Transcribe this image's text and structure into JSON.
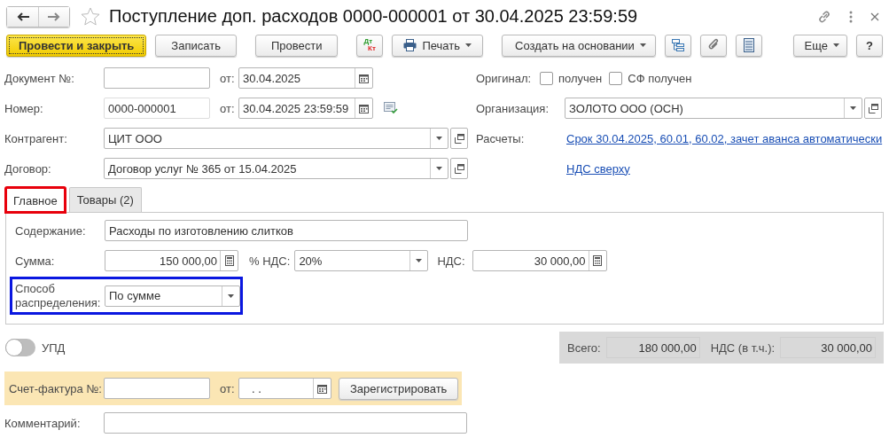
{
  "window": {
    "title": "Поступление доп. расходов 0000-000001 от 30.04.2025 23:59:59"
  },
  "toolbar": [
    {
      "kind": "primary",
      "label": "Провести и закрыть"
    },
    {
      "kind": "plain",
      "label": "Записать"
    },
    {
      "kind": "plain",
      "label": "Провести"
    },
    {
      "kind": "dtkt",
      "top": "Дт",
      "bottom": "Кт"
    },
    {
      "kind": "print",
      "label": "Печать"
    },
    {
      "kind": "menu",
      "label": "Создать на основании"
    },
    {
      "kind": "structure"
    },
    {
      "kind": "clip"
    },
    {
      "kind": "list"
    },
    {
      "kind": "more",
      "label": "Еще"
    },
    {
      "kind": "help",
      "label": "?"
    }
  ],
  "document": {
    "label": "Документ №:",
    "date_label": "от:",
    "date": "30.04.2025"
  },
  "number": {
    "label": "Номер:",
    "value": "0000-000001",
    "date_label": "от:",
    "datetime": "30.04.2025 23:59:59"
  },
  "counterparty": {
    "label": "Контрагент:",
    "value": "ЦИТ ООО"
  },
  "contract": {
    "label": "Договор:",
    "value": "Договор услуг № 365 от 15.04.2025"
  },
  "original": {
    "label": "Оригинал:",
    "checkboxes": [
      {
        "label": "получен",
        "checked": false
      },
      {
        "label": "СФ получен",
        "checked": false
      }
    ]
  },
  "organization": {
    "label": "Организация:",
    "value": "ЗОЛОТО ООО (ОСН)"
  },
  "settlements": {
    "label": "Расчеты:",
    "link": "Срок 30.04.2025, 60.01, 60.02, зачет аванса автоматически"
  },
  "vat_link": "НДС сверху",
  "tabs": [
    {
      "label": "Главное",
      "selected": true,
      "highlighted": true
    },
    {
      "label": "Товары (2)",
      "selected": false,
      "highlighted": false
    }
  ],
  "main_tab": {
    "content": {
      "label": "Содержание:",
      "value": "Расходы по изготовлению слитков"
    },
    "amount": {
      "label": "Сумма:",
      "value": "150 000,00"
    },
    "vat_rate": {
      "label": "% НДС:",
      "value": "20%"
    },
    "vat": {
      "label": "НДС:",
      "value": "30 000,00"
    },
    "distribution": {
      "label": "Способ распределения:",
      "value": "По сумме",
      "highlighted": true
    }
  },
  "upd": {
    "label": "УПД",
    "on": false
  },
  "totals": [
    {
      "label": "Всего:",
      "value": "180 000,00"
    },
    {
      "label": "НДС (в т.ч.):",
      "value": "30 000,00"
    }
  ],
  "invoice": {
    "label": "Счет-фактура №:",
    "date_label": "от:",
    "date": ". .",
    "button": "Зарегистрировать"
  },
  "comment": {
    "label": "Комментарий:"
  }
}
